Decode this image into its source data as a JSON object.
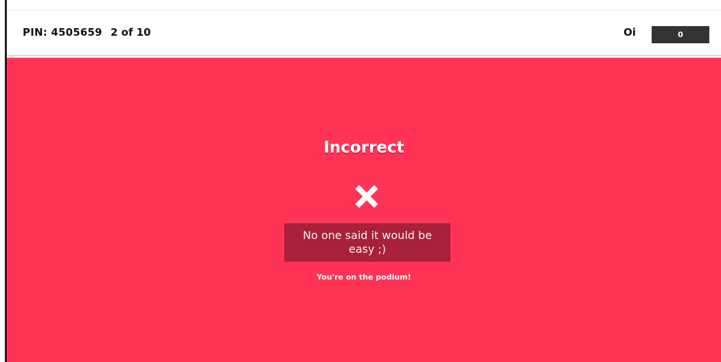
{
  "header": {
    "pin_label": "PIN: 4505659",
    "progress": "2 of 10",
    "player_name": "Oi",
    "score": "0"
  },
  "result": {
    "title": "Incorrect",
    "icon": "x-icon",
    "message": "No one said it would be easy ;)",
    "podium_text": "You're on the podium!"
  },
  "colors": {
    "background": "#ff3355",
    "message_box": "#a8203a",
    "score_box": "#333333"
  }
}
